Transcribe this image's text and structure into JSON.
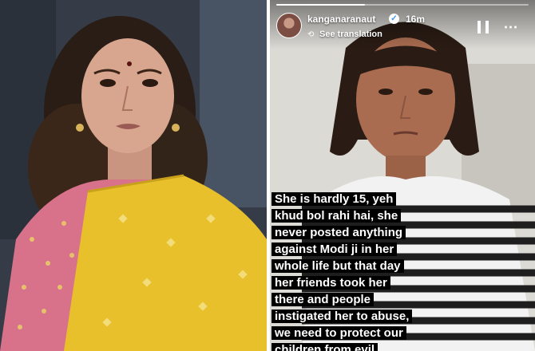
{
  "story": {
    "username": "kanganaranaut",
    "verified_mark": "✓",
    "time_ago": "16m",
    "translation_label": "See translation",
    "translate_icon": "⟲",
    "pause_icon": "pause-icon",
    "more_icon": "⋯",
    "progress": 0.35,
    "caption_lines": [
      "She is hardly 15, yeh",
      "khud bol rahi hai, she",
      "never posted anything",
      "against Modi ji in her",
      "whole life but that day",
      "her friends took her",
      "there and people",
      "instigated her to abuse,",
      "we need to protect our",
      "children from evil"
    ]
  },
  "colors": {
    "saree": "#e8c02c",
    "blouse": "#d8728a",
    "caption_bg": "#000000",
    "verified_blue": "#3897f0"
  }
}
